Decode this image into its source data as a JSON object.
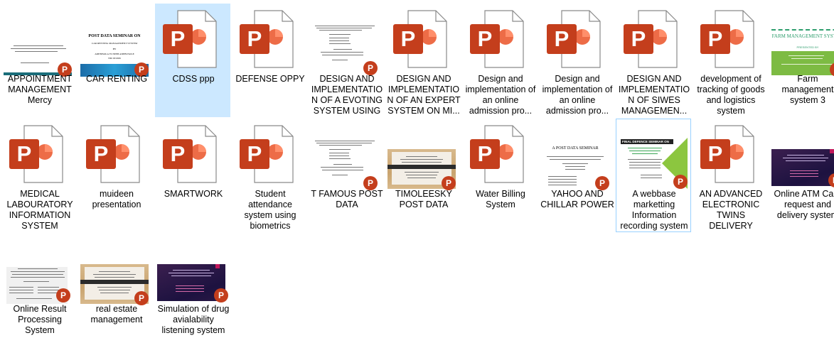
{
  "files": [
    {
      "name": "APPOINTMENT MANAGEMENT Mercy",
      "thumb": "slide-teal-bottom"
    },
    {
      "name": "CAR RENTING",
      "thumb": "slide-title",
      "slide_title": "POST DATA SEMINAR ON",
      "slide_subtitle": "CAR RENTING MANAGEMENT SYSTEM",
      "slide_by": "BY",
      "slide_author": "ADEBISOLA YUSEEB ADEBUSOLE",
      "slide_id": "ND/18/1606"
    },
    {
      "name": "CDSS ppp",
      "thumb": "ppt-icon",
      "selected": true
    },
    {
      "name": "DEFENSE OPPY",
      "thumb": "ppt-icon"
    },
    {
      "name": "DESIGN AND IMPLEMENTATIO N OF A EVOTING SYSTEM USING ...",
      "thumb": "slide-text"
    },
    {
      "name": "DESIGN AND IMPLEMENTATIO N OF AN EXPERT SYSTEM ON MI...",
      "thumb": "ppt-icon"
    },
    {
      "name": "Design and implementation of an online admission pro...",
      "thumb": "ppt-icon"
    },
    {
      "name": "Design and implementation of an online admission pro...",
      "thumb": "ppt-icon"
    },
    {
      "name": "DESIGN AND IMPLEMENTATIO N OF SIWES MANAGEMEN...",
      "thumb": "ppt-icon"
    },
    {
      "name": "development of tracking of goods and logistics system",
      "thumb": "ppt-icon"
    },
    {
      "name": "Farm management system 3",
      "thumb": "slide-green",
      "slide_title": "FARM MANAGEMENT SYSTEM",
      "slide_sub": "PRESENTED BY"
    },
    {
      "name": "MEDICAL LABOURATORY INFORMATION SYSTEM",
      "thumb": "ppt-icon"
    },
    {
      "name": "muideen presentation",
      "thumb": "ppt-icon"
    },
    {
      "name": "SMARTWORK",
      "thumb": "ppt-icon"
    },
    {
      "name": "Student attendance system using biometrics",
      "thumb": "ppt-icon"
    },
    {
      "name": "T FAMOUS POST DATA",
      "thumb": "slide-text"
    },
    {
      "name": "TIMOLEESKY POST DATA",
      "thumb": "slide-wood"
    },
    {
      "name": "Water Billing System",
      "thumb": "ppt-icon"
    },
    {
      "name": "YAHOO AND CHILLAR POWER",
      "thumb": "slide-seminar",
      "slide_title": "A POST DATA SEMINAR"
    },
    {
      "name": "A webbase marketting Information recording system",
      "thumb": "slide-defence",
      "focused": true,
      "slide_title": "FINAL DEFENCE SEMINAR ON"
    },
    {
      "name": "AN ADVANCED ELECTRONIC TWINS DELIVERY RECORD MAN...",
      "thumb": "ppt-icon"
    },
    {
      "name": "Online ATM Card request and delivery system",
      "thumb": "slide-purple"
    },
    {
      "name": "Online Result Processing System",
      "thumb": "slide-grey"
    },
    {
      "name": "real estate management",
      "thumb": "slide-wood"
    },
    {
      "name": "Simulation of drug avialability listening system",
      "thumb": "slide-purple"
    }
  ],
  "colors": {
    "ppt_red": "#c43e1c",
    "selection": "#cce8ff",
    "focus_border": "#99d1ff"
  }
}
